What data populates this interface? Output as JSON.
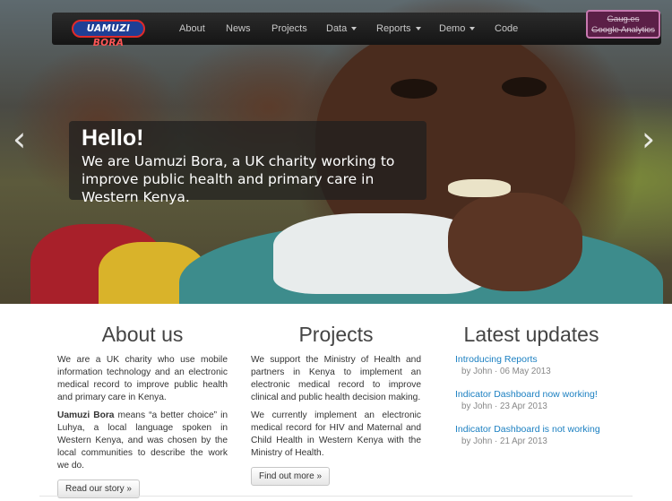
{
  "brand": {
    "part1": "UAMUZI",
    "part2": "BORA"
  },
  "nav": {
    "items": [
      {
        "label": "About",
        "dropdown": false
      },
      {
        "label": "News",
        "dropdown": false
      },
      {
        "label": "Projects",
        "dropdown": false
      },
      {
        "label": "Data",
        "dropdown": true
      },
      {
        "label": "Reports",
        "dropdown": true
      },
      {
        "label": "Demo",
        "dropdown": true
      },
      {
        "label": "Code",
        "dropdown": false
      }
    ],
    "ga_button": {
      "line1": "Gaug.es",
      "line2": "Google Analytics"
    }
  },
  "hero": {
    "heading": "Hello!",
    "text": "We are Uamuzi Bora, a UK charity working to improve public health and primary care in Western Kenya.",
    "prev_icon": "‹",
    "next_icon": "›"
  },
  "about": {
    "title": "About us",
    "p1": "We are a UK charity who use mobile information technology and an electronic medical record to improve public health and primary care in Kenya.",
    "p2_bold": "Uamuzi Bora",
    "p2_rest": " means “a better choice” in Luhya, a local language spoken in Western Kenya, and was chosen by the local communities to describe the work we do.",
    "button": "Read our story »"
  },
  "projects": {
    "title": "Projects",
    "p1": "We support the Ministry of Health and partners in Kenya to implement an electronic medical record to improve clinical and public health decision making.",
    "p2": "We currently implement an electronic medical record for HIV and Maternal and Child Health in Western Kenya with the Ministry of Health.",
    "button": "Find out more »"
  },
  "updates": {
    "title": "Latest updates",
    "items": [
      {
        "title": "Introducing Reports",
        "meta": "by John · 06 May 2013"
      },
      {
        "title": "Indicator Dashboard now working!",
        "meta": "by John · 23 Apr 2013"
      },
      {
        "title": "Indicator Dashboard is not working",
        "meta": "by John · 21 Apr 2013"
      }
    ]
  },
  "colors": {
    "link": "#1a7fc1",
    "navbar": "#1c1c1c",
    "brand_blue": "#1f3f95",
    "brand_red": "#e02a2a"
  }
}
